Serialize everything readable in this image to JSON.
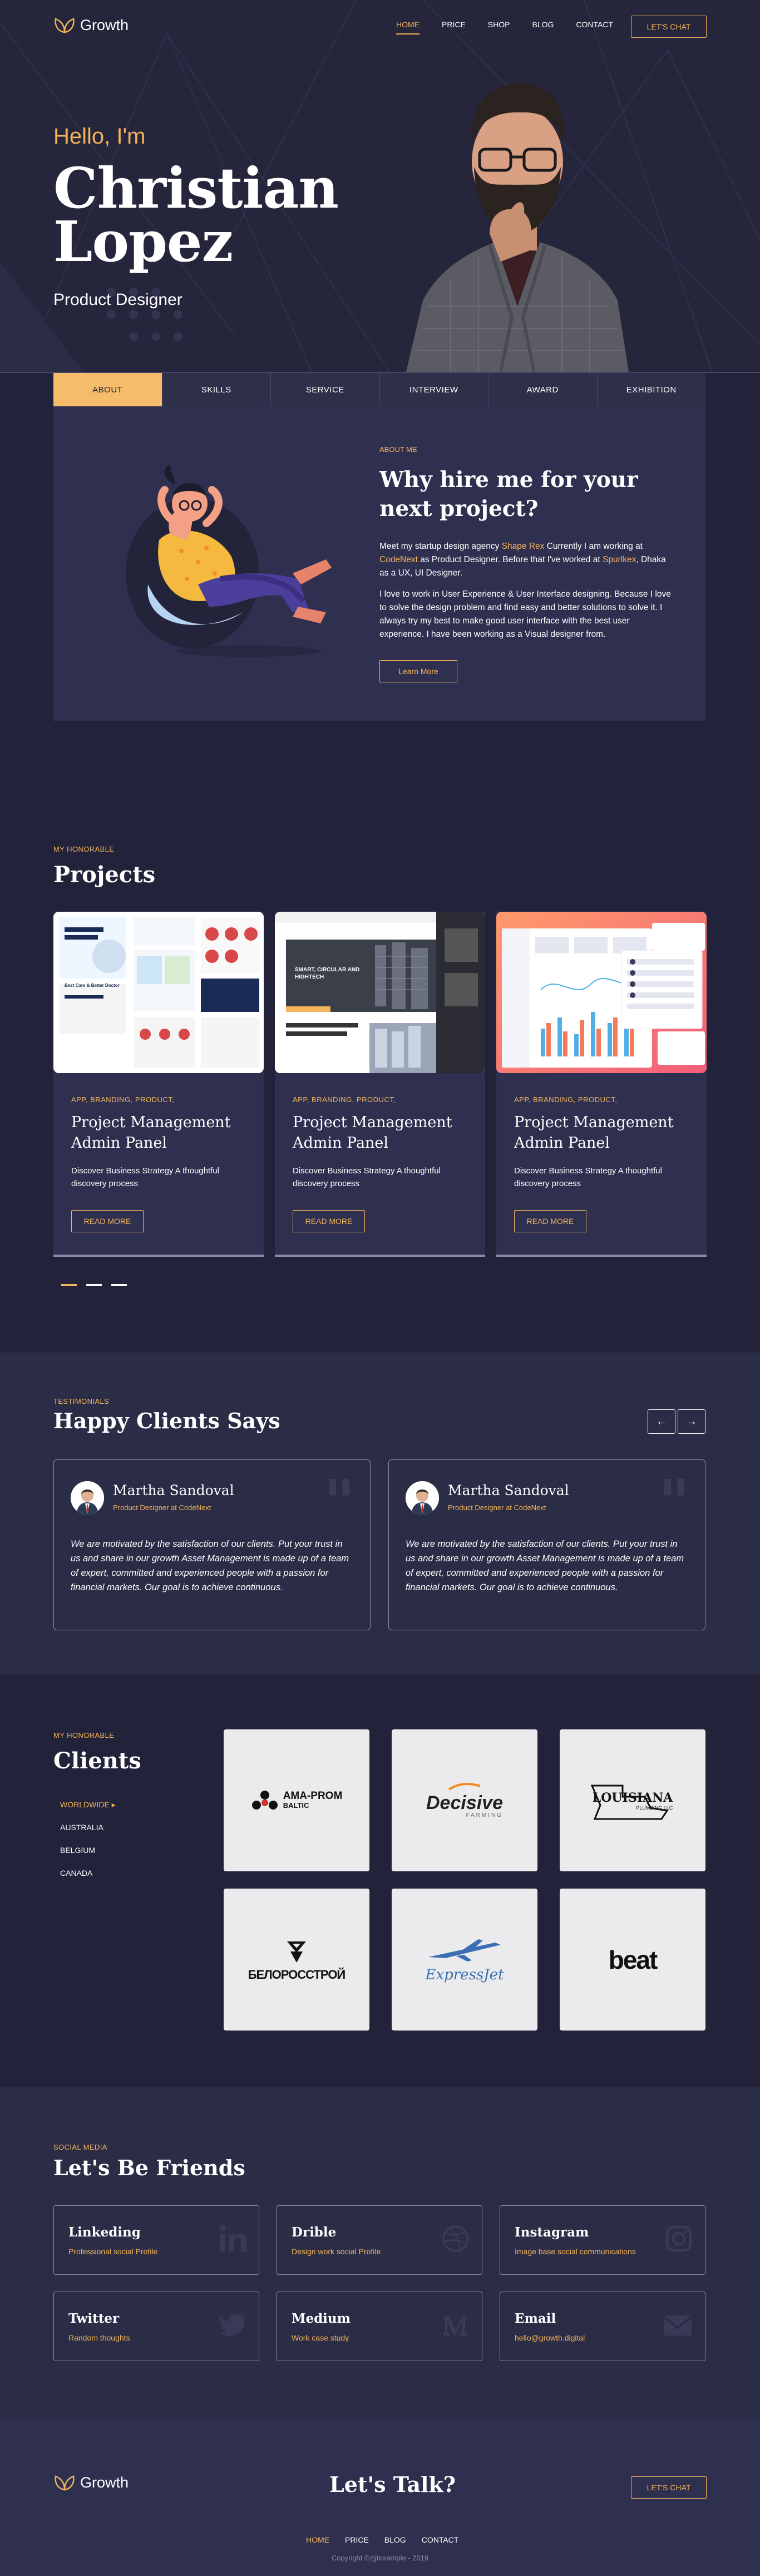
{
  "brand": {
    "name": "Growth",
    "accent": "#f3b45a",
    "bg": "#22233a"
  },
  "nav": {
    "items": [
      {
        "label": "HOME",
        "active": true
      },
      {
        "label": "PRICE"
      },
      {
        "label": "SHOP"
      },
      {
        "label": "BLOG"
      },
      {
        "label": "CONTACT"
      }
    ],
    "cta": "LET'S CHAT"
  },
  "hero": {
    "greeting": "Hello, I'm",
    "first_name": "Christian",
    "last_name": "Lopez",
    "role": "Product Designer"
  },
  "tabs": [
    "ABOUT",
    "SKILLS",
    "SERVICE",
    "INTERVIEW",
    "AWARD",
    "EXHIBITION"
  ],
  "about": {
    "eyebrow": "ABOUT ME",
    "title": "Why hire me for your next project?",
    "p1_a": "Meet my startup design agency ",
    "p1_link1": "Shape Rex",
    "p1_b": " Currently I am working at ",
    "p1_link2": "CodeNext",
    "p1_c": " as Product Designer. Before that I've worked at ",
    "p1_link3": "Spurlkex",
    "p1_d": ", Dhaka as a UX, UI Designer.",
    "p2": "I love to work in User Experience & User Interface designing. Because I love to solve the design problem and find easy and better solutions to solve it. I always try my best to make good user interface with the best user experience. I have been working as a Visual designer from.",
    "button": "Learn More"
  },
  "projects": {
    "eyebrow": "MY HONORABLE",
    "title": "Projects",
    "cards": [
      {
        "tags": "APP,   BRANDING,   PRODUCT,",
        "title": "Project Management Admin Panel",
        "desc": "Discover Business Strategy A thoughtful discovery process",
        "button": "READ MORE",
        "thumb_heading": "Best Care & Better Doctor"
      },
      {
        "tags": "APP,   BRANDING,   PRODUCT,",
        "title": "Project Management Admin Panel",
        "desc": "Discover Business Strategy A thoughtful discovery process",
        "button": "READ MORE",
        "thumb_heading": "SMART, CIRCULAR AND HIGHTECH"
      },
      {
        "tags": "APP,   BRANDING,   PRODUCT,",
        "title": "Project Management Admin Panel",
        "desc": "Discover Business Strategy A thoughtful discovery process",
        "button": "READ MORE",
        "thumb_heading": ""
      }
    ]
  },
  "testimonials": {
    "eyebrow": "TESTIMONIALS",
    "title": "Happy Clients Says",
    "prev": "←",
    "next": "→",
    "items": [
      {
        "name": "Martha Sandoval",
        "role": "Product Designer at CodeNext",
        "text": "We are motivated by the satisfaction of our clients. Put your trust in us and share in our growth Asset Management is made up of a team of expert, committed and experienced people with a passion for financial markets. Our goal is to achieve continuous."
      },
      {
        "name": "Martha Sandoval",
        "role": "Product Designer at CodeNext",
        "text": "We are motivated by the satisfaction of our clients. Put your trust in us and share in our growth Asset Management is made up of a team of expert, committed and experienced people with a passion for financial markets. Our goal is to achieve continuous."
      }
    ]
  },
  "clients": {
    "eyebrow": "MY HONORABLE",
    "title": "Clients",
    "regions": [
      {
        "label": "WORLDWIDE",
        "active": true
      },
      {
        "label": "AUSTRALIA"
      },
      {
        "label": "BELGIUM"
      },
      {
        "label": "CANADA"
      }
    ],
    "logos": [
      {
        "name": "AMA-PROM BALTIC",
        "l1": "AMA-PROM",
        "l2": "BALTIC"
      },
      {
        "name": "Decisive Farming",
        "l1": "Decisive",
        "l2": "FARMING"
      },
      {
        "name": "Louisiana Plumbing",
        "l1": "LOUISIANA",
        "l2": "PLUMBING LLC"
      },
      {
        "name": "Белоросстрой",
        "l1": "БЕЛОРОССТРОЙ"
      },
      {
        "name": "ExpressJet",
        "l1": "ExpressJet"
      },
      {
        "name": "beat",
        "l1": "beat"
      }
    ]
  },
  "social": {
    "eyebrow": "SOCIAL MEDIA",
    "title": "Let's Be Friends",
    "items": [
      {
        "title": "Linkeding",
        "desc": "Professional social Profile",
        "icon": "linkedin-icon"
      },
      {
        "title": "Drible",
        "desc": "Design work social Profile",
        "icon": "dribbble-icon"
      },
      {
        "title": "Instagram",
        "desc": "Image base social communications",
        "icon": "instagram-icon"
      },
      {
        "title": "Twitter",
        "desc": "Random thoughts",
        "icon": "twitter-icon"
      },
      {
        "title": "Medium",
        "desc": "Work case study",
        "icon": "medium-icon"
      },
      {
        "title": "Email",
        "desc": "hello@growth.digital",
        "icon": "mail-icon"
      }
    ]
  },
  "footer": {
    "title": "Let's Talk?",
    "cta": "LET'S CHAT",
    "nav": [
      {
        "label": "HOME",
        "active": true
      },
      {
        "label": "PRICE"
      },
      {
        "label": "BLOG"
      },
      {
        "label": "CONTACT"
      }
    ],
    "copyright": "Copyright ©zjjtexample - 2019"
  }
}
